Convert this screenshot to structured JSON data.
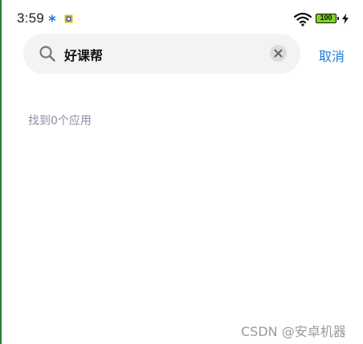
{
  "status_bar": {
    "time": "3:59",
    "battery_level": "100",
    "notification_icons": [
      "snowflake-notification-icon",
      "app-notification-icon"
    ],
    "wifi_icon": "wifi-icon",
    "charging_icon": "charging-bolt-icon"
  },
  "search": {
    "value": "好课帮",
    "search_icon": "search-icon",
    "clear_icon": "clear-icon",
    "cancel_label": "取消"
  },
  "results": {
    "count_text": "找到0个应用"
  },
  "watermark": "CSDN @安卓机器",
  "colors": {
    "accent": "#1f7bd6",
    "search_bg": "#f3f3f3",
    "muted_text": "#8a8fa6",
    "battery": "#7ed321"
  }
}
